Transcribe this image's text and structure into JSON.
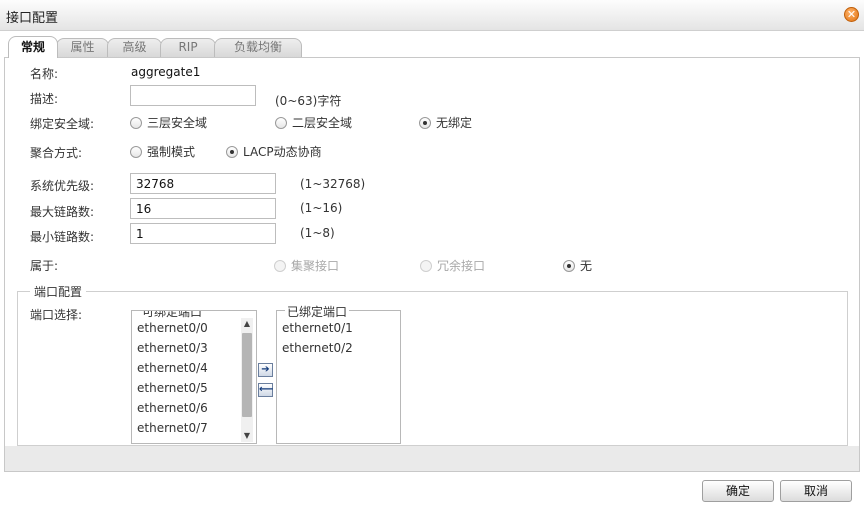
{
  "window": {
    "title": "接口配置",
    "close_icon": "close-icon"
  },
  "tabs": [
    {
      "label": "常规",
      "active": true
    },
    {
      "label": "属性",
      "active": false
    },
    {
      "label": "高级",
      "active": false
    },
    {
      "label": "RIP",
      "active": false
    },
    {
      "label": "负载均衡",
      "active": false
    }
  ],
  "form": {
    "name_label": "名称:",
    "name_value": "aggregate1",
    "desc_label": "描述:",
    "desc_value": "",
    "desc_hint": "(0~63)字符",
    "zone_label": "绑定安全域:",
    "zone_options": [
      {
        "label": "三层安全域",
        "checked": false
      },
      {
        "label": "二层安全域",
        "checked": false
      },
      {
        "label": "无绑定",
        "checked": true
      }
    ],
    "agg_label": "聚合方式:",
    "agg_options": [
      {
        "label": "强制模式",
        "checked": false
      },
      {
        "label": "LACP动态协商",
        "checked": true
      }
    ],
    "priority_label": "系统优先级:",
    "priority_value": "32768",
    "priority_hint": "(1~32768)",
    "max_label": "最大链路数:",
    "max_value": "16",
    "max_hint": "(1~16)",
    "min_label": "最小链路数:",
    "min_value": "1",
    "min_hint": "(1~8)",
    "belong_label": "属于:",
    "belong_options": [
      {
        "label": "集聚接口",
        "checked": false,
        "disabled": true
      },
      {
        "label": "冗余接口",
        "checked": false,
        "disabled": true
      },
      {
        "label": "无",
        "checked": true,
        "disabled": false
      }
    ]
  },
  "ports": {
    "section_title": "端口配置",
    "select_label": "端口选择:",
    "available_title": "可绑定端口",
    "available": [
      "ethernet0/0",
      "ethernet0/3",
      "ethernet0/4",
      "ethernet0/5",
      "ethernet0/6",
      "ethernet0/7"
    ],
    "bound_title": "已绑定端口",
    "bound": [
      "ethernet0/1",
      "ethernet0/2"
    ],
    "add_icon": "arrow-right-icon",
    "remove_icon": "arrow-left-icon"
  },
  "footer": {
    "ok_label": "确定",
    "cancel_label": "取消"
  }
}
